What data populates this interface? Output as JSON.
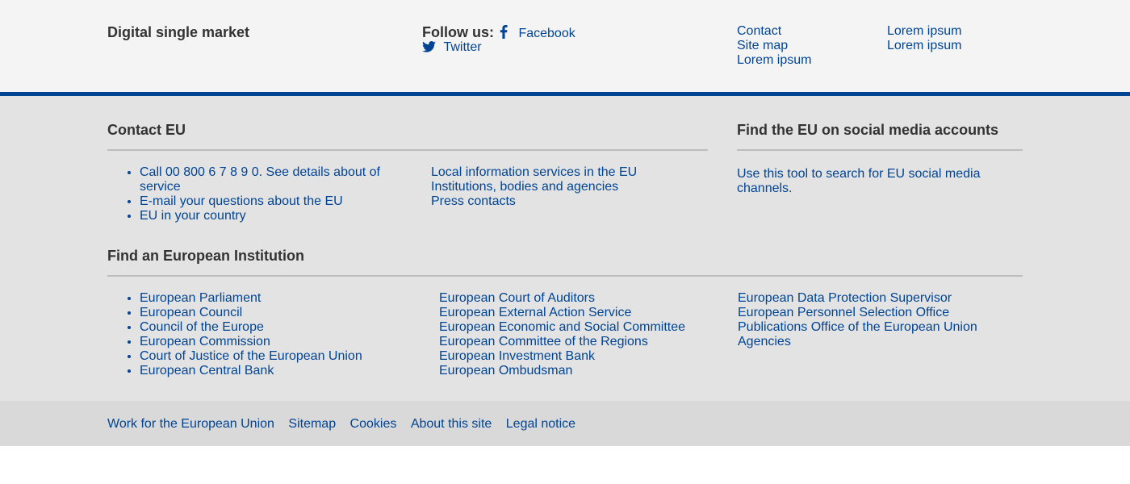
{
  "header": {
    "site_name": "Digital single market",
    "follow_label": "Follow us:",
    "social": [
      {
        "label": "Facebook",
        "icon": "facebook-icon"
      },
      {
        "label": "Twitter",
        "icon": "twitter-icon"
      }
    ],
    "links_col1": [
      "Contact",
      "Site map",
      "Lorem ipsum"
    ],
    "links_col2": [
      "Lorem ipsum",
      "Lorem ipsum"
    ]
  },
  "contact": {
    "title": "Contact EU",
    "list_left": [
      "Call 00 800 6 7 8 9 0. See details about of service",
      "E-mail your questions about the EU",
      "EU in your country"
    ],
    "list_right": [
      "Local information services in the EU",
      "Institutions, bodies and agencies",
      "Press contacts"
    ]
  },
  "social_media": {
    "title": "Find the EU on social media accounts",
    "text": "Use this tool to search for EU social media channels."
  },
  "institutions": {
    "title": "Find an European Institution",
    "col1": [
      "European Parliament",
      "European Council",
      "Council of the Europe",
      "European Commission",
      "Court of Justice of the European Union",
      "European Central Bank"
    ],
    "col2": [
      "European Court of Auditors",
      "European External Action Service",
      "European Economic and Social Committee",
      "European Committee of the Regions",
      "European Investment Bank",
      "European Ombudsman"
    ],
    "col3": [
      "European Data Protection Supervisor",
      "European Personnel Selection Office",
      "Publications Office of the European Union",
      "Agencies"
    ]
  },
  "footer": {
    "links": [
      "Work for the European Union",
      "Sitemap",
      "Cookies",
      "About this site",
      "Legal notice"
    ]
  },
  "colors": {
    "link": "#004494",
    "accent_bar": "#004494",
    "top_bg": "#f4f4f4",
    "mid_bg": "#e3e3e3",
    "bottom_bg": "#d9d9d9"
  }
}
